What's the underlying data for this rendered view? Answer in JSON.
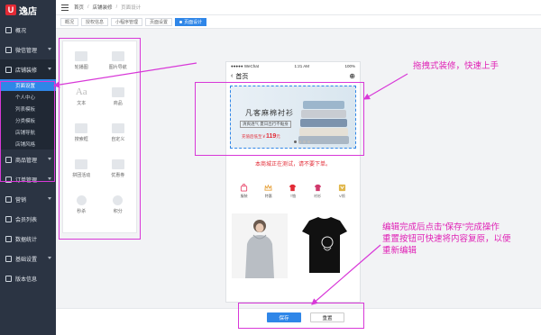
{
  "app": {
    "logo_char": "U",
    "name": "逸店"
  },
  "sidebar": {
    "items": [
      {
        "label": "概况",
        "icon": "dashboard-icon"
      },
      {
        "label": "微信管理",
        "icon": "wechat-icon"
      },
      {
        "label": "店铺装修",
        "icon": "shop-icon"
      },
      {
        "label": "商品管理",
        "icon": "goods-icon"
      },
      {
        "label": "订单管理",
        "icon": "order-icon"
      },
      {
        "label": "营销",
        "icon": "marketing-icon"
      },
      {
        "label": "会员列表",
        "icon": "member-icon"
      },
      {
        "label": "数据统计",
        "icon": "stats-icon"
      },
      {
        "label": "基础设置",
        "icon": "settings-icon"
      },
      {
        "label": "版本信息",
        "icon": "info-icon"
      }
    ],
    "sub_items": [
      "页面设置",
      "个人中心",
      "列表模板",
      "分类模板",
      "店铺导航",
      "店铺风格"
    ]
  },
  "breadcrumb": {
    "home": "首页",
    "parent": "店铺装修",
    "current": "页面设计"
  },
  "tabs": [
    "概况",
    "授权信息",
    "小程序管理",
    "页面设置",
    "页面设计"
  ],
  "widgets": [
    "轮播图",
    "图片导航",
    "文本",
    "商品",
    "搜索框",
    "自定义",
    "拼团活动",
    "优惠券",
    "秒杀",
    "积分"
  ],
  "phone": {
    "carrier": "●●●●● WeChat",
    "time": "1:21 AM",
    "battery": "100%",
    "title": "首页",
    "banner_title": "凡客麻棉衬衫",
    "banner_sub": "清爽透气 夏日出行不黏身",
    "banner_price_prefix": "充值后低至￥",
    "banner_price": "119",
    "banner_price_suffix": "元",
    "notice": "本商城正在测试，请不要下单。",
    "categories": [
      "服装",
      "特惠",
      "T恤",
      "衬衫",
      "V领"
    ]
  },
  "buttons": {
    "save": "保存",
    "reset": "重置"
  },
  "annotations": {
    "drag": "拖拽式装修，快速上手",
    "save_line1": "编辑完成后点击”保存”完成操作",
    "save_line2": "重置按钮可快速将内容复原，以便",
    "save_line3": "重新编辑"
  },
  "colors": {
    "accent": "#2f86e8",
    "brand": "#e22a35",
    "annotation": "#d838d8",
    "sidebar": "#2b3443"
  }
}
